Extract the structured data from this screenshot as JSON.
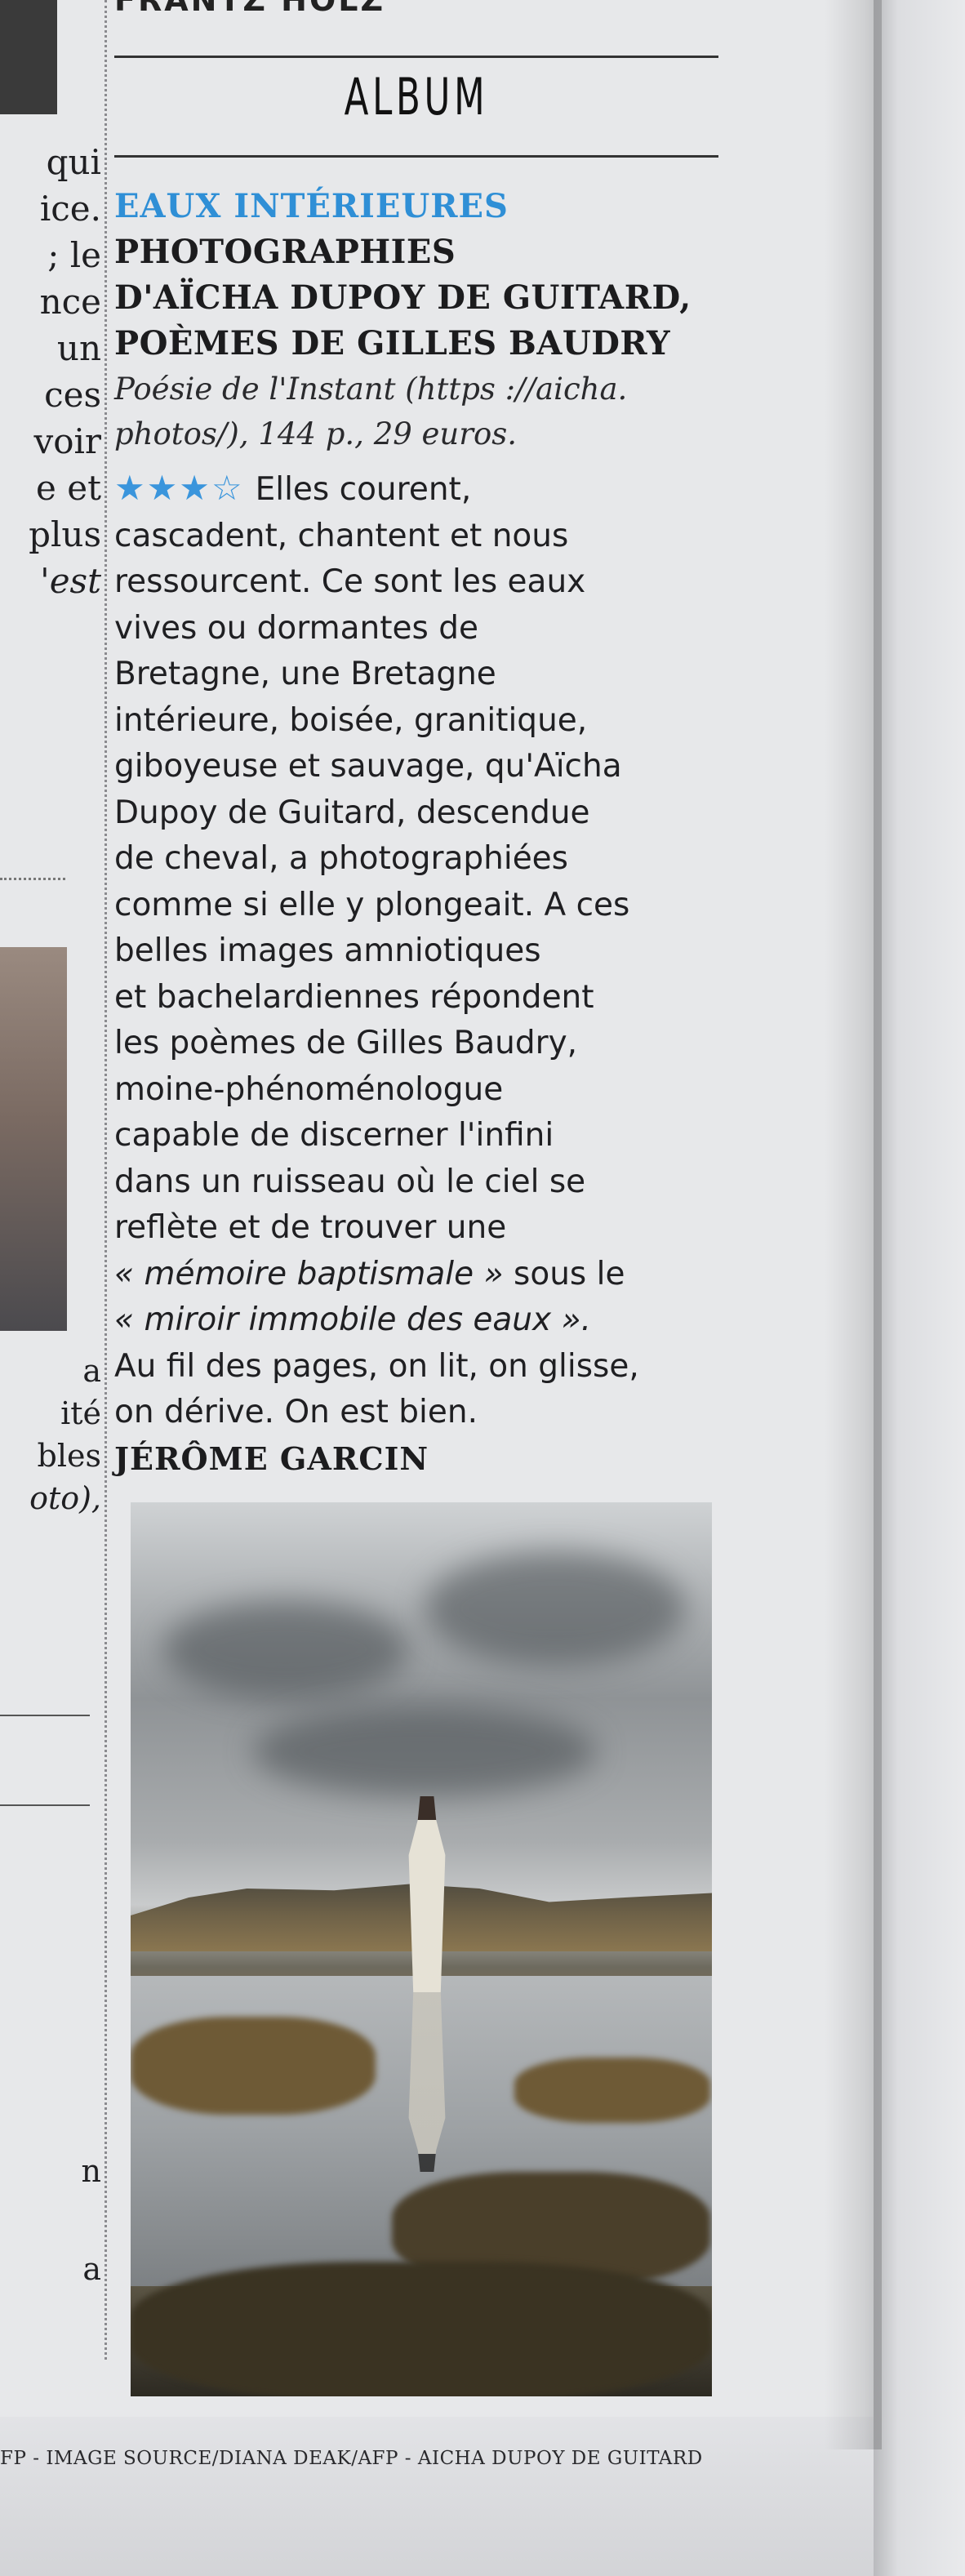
{
  "top_cut_text": "FRANTZ HOLZ",
  "section": "ALBUM",
  "headline": {
    "kicker": "EAUX INTÉRIEURES",
    "title_lines": [
      "PHOTOGRAPHIES",
      "D'AÏCHA DUPOY DE GUITARD,",
      "POÈMES DE GILLES BAUDRY"
    ],
    "publication_lines": [
      "Poésie de l'Instant (https ://aicha.",
      "photos/), 144 p., 29 euros."
    ]
  },
  "rating": {
    "stars_text": "★★★☆",
    "value": 3,
    "max": 4
  },
  "body_lines": [
    "Elles courent,",
    "cascadent, chantent et nous",
    "ressourcent. Ce sont les eaux",
    "vives ou dormantes de",
    "Bretagne, une Bretagne",
    "intérieure, boisée, granitique,",
    "giboyeuse et sauvage, qu'Aïcha",
    "Dupoy de Guitard, descendue",
    "de cheval, a photographiées",
    "comme si elle y plongeait. A ces",
    "belles images amniotiques",
    "et bachelardiennes répondent",
    "les poèmes de Gilles Baudry,",
    "moine-phénoménologue",
    "capable de discerner l'infini",
    "dans un ruisseau où le ciel se",
    "reflète et de trouver une",
    "« mémoire baptismale »",
    "sous le",
    "« miroir immobile des eaux ».",
    "Au fil des pages, on lit, on glisse,",
    "on dérive. On est bien."
  ],
  "signature": "JÉRÔME GARCIN",
  "left_column_fragments": [
    "qui",
    "ice.",
    "; le",
    "nce",
    "un",
    "ces",
    "voir",
    "e et",
    "plus",
    "'est",
    "a",
    "ité",
    "bles",
    "oto),",
    "n",
    "a"
  ],
  "photo_credit": "FP - IMAGE SOURCE/DIANA DEAK/AFP - AICHA DUPOY DE GUITARD"
}
